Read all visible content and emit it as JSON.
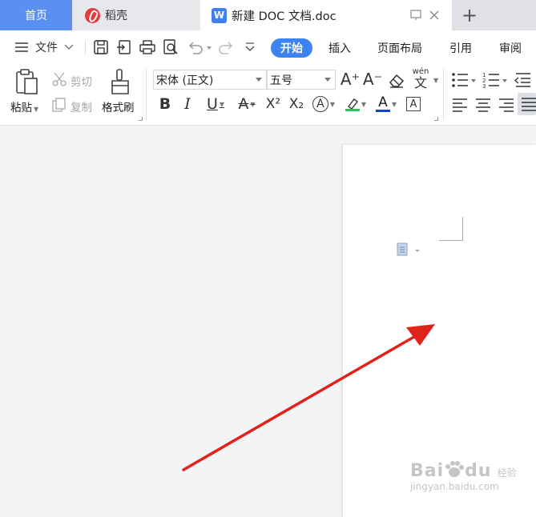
{
  "tabs": {
    "home_label": "首页",
    "daoke_label": "稻壳",
    "doc_label": "新建 DOC 文档.doc",
    "doc_icon_letter": "W",
    "new_tab_symbol": "+"
  },
  "menu": {
    "file_label": "文件",
    "tabs": [
      "开始",
      "插入",
      "页面布局",
      "引用",
      "审阅"
    ]
  },
  "ribbon": {
    "paste_label": "粘贴",
    "cut_label": "剪切",
    "copy_label": "复制",
    "format_painter_label": "格式刷",
    "font_name": "宋体 (正文)",
    "font_size": "五号",
    "bold": "B",
    "italic": "I",
    "underline": "U",
    "strikethrough": "A",
    "superscript": "X²",
    "subscript": "X₂",
    "char_effect": "A",
    "highlight": "A",
    "font_color": "A",
    "char_border": "A",
    "grow_font": "A⁺",
    "shrink_font": "A⁻",
    "pinyin_label": "wén",
    "pinyin_char": "文"
  },
  "colors": {
    "accent": "#3c82f0",
    "home_tab": "#5b8ff1",
    "highlight_bar": "#2fc25b",
    "font_color_bar": "#1a3fd6",
    "arrow": "#e0231a"
  },
  "watermark": {
    "brand": "Bai",
    "brand2": "du",
    "sub": "经验",
    "url": "jingyan.baidu.com"
  }
}
